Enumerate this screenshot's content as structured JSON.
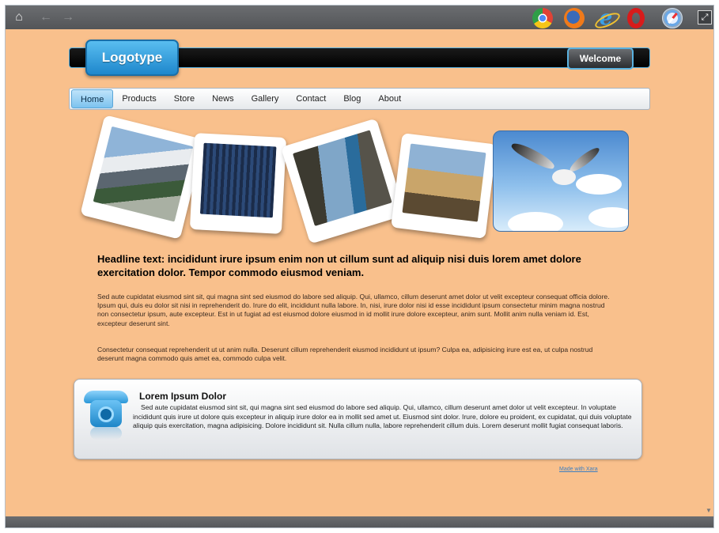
{
  "toolbar": {
    "home_icon": "home-icon",
    "back_icon": "back-arrow-icon",
    "forward_icon": "forward-arrow-icon",
    "browsers": [
      "chrome-icon",
      "firefox-icon",
      "ie-icon",
      "opera-icon",
      "safari-icon"
    ],
    "maximize_icon": "maximize-icon"
  },
  "header": {
    "logo": "Logotype",
    "welcome": "Welcome"
  },
  "nav": {
    "items": [
      "Home",
      "Products",
      "Store",
      "News",
      "Gallery",
      "Contact",
      "Blog",
      "About"
    ],
    "active": "Home"
  },
  "main": {
    "headline": "Headline text: incididunt irure ipsum enim non ut cillum sunt ad aliquip nisi duis lorem amet dolore exercitation dolor. Tempor commodo eiusmod veniam.",
    "paragraph1": "Sed aute cupidatat eiusmod sint sit, qui magna sint sed eiusmod do labore sed aliquip. Qui, ullamco, cillum deserunt amet dolor ut velit excepteur consequat officia dolore. Ipsum qui, duis eu dolor sit nisi in reprehenderit do. Irure do elit, incididunt nulla labore. In, nisi, irure dolor nisi id esse incididunt ipsum consectetur minim magna nostrud non consectetur ipsum, aute excepteur. Est in ut fugiat ad est eiusmod dolore eiusmod in id mollit irure dolore excepteur, anim sunt. Mollit anim nulla veniam id. Est, excepteur deserunt sint.",
    "paragraph2": "Consectetur consequat reprehenderit ut ut anim nulla. Deserunt cillum reprehenderit eiusmod incididunt ut ipsum? Culpa ea, adipisicing irure est ea, ut culpa nostrud deserunt magna commodo quis amet ea, commodo culpa velit."
  },
  "contact": {
    "title": "Lorem Ipsum Dolor",
    "text": "Sed aute cupidatat eiusmod sint sit, qui magna sint sed eiusmod do labore sed aliquip. Qui, ullamco, cillum deserunt amet dolor ut velit excepteur. In voluptate incididunt quis irure ut dolore quis excepteur in aliquip irure dolor ea in mollit sed amet ut. Eiusmod sint dolor. Irure, dolore eu proident, ex cupidatat, qui duis voluptate aliquip quis exercitation, magna adipisicing. Dolore incididunt sit. Nulla cillum nulla, labore reprehenderit cillum duis. Lorem deserunt mollit fugiat consequat laboris.",
    "icon": "telephone-icon"
  },
  "footer": {
    "credit": "Made with Xara"
  },
  "colors": {
    "page_bg": "#f9c08c",
    "accent": "#2a97d8",
    "toolbar": "#5f6164"
  }
}
